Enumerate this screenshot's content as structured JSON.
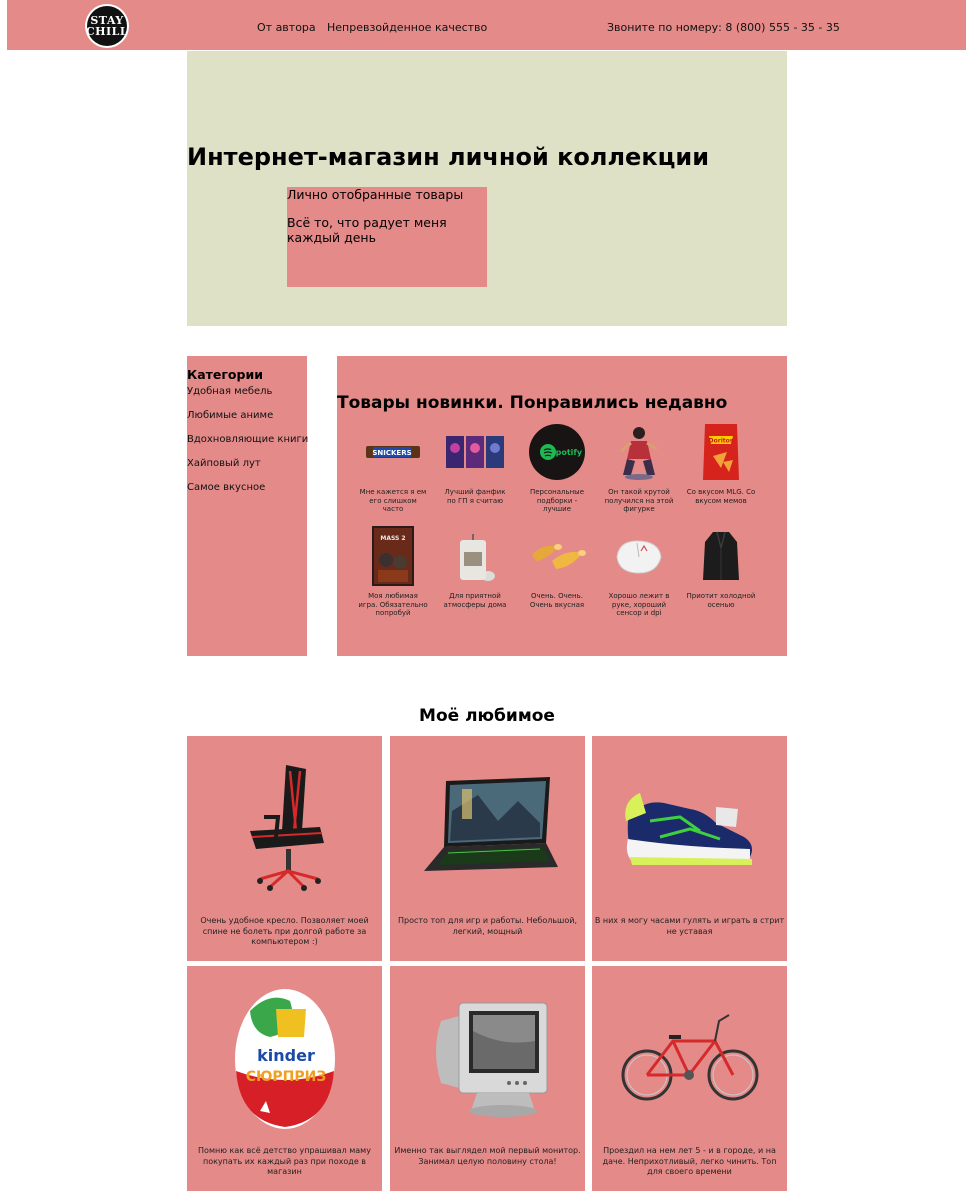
{
  "header": {
    "logo_text": "STAY CHILL",
    "nav": [
      "От автора",
      "Непревзойденное качество"
    ],
    "phone": "Звоните по номеру: 8 (800) 555 - 35 - 35"
  },
  "hero": {
    "title": "Интернет-магазин личной коллекции",
    "line1": "Лично отобранные товары",
    "line2": "Всё то, что радует меня каждый день"
  },
  "categories": {
    "title": "Категории",
    "items": [
      "Удобная мебель",
      "Любимые аниме",
      "Вдохновляющие книги",
      "Хайповый лут",
      "Самое вкусное"
    ]
  },
  "new_products": {
    "title": "Товары новинки. Понравились недавно",
    "items": [
      {
        "icon": "snickers-icon",
        "caption": "Мне кажется я ем его слишком часто"
      },
      {
        "icon": "fanfic-books-icon",
        "caption": "Лучший фанфик по ГП я считаю"
      },
      {
        "icon": "spotify-icon",
        "caption": "Персональные подборки - лучшие"
      },
      {
        "icon": "figurine-icon",
        "caption": "Он такой крутой получился на этой фигурке"
      },
      {
        "icon": "doritos-icon",
        "caption": "Со вкусом MLG. Со вкусом мемов"
      },
      {
        "icon": "mass-effect-icon",
        "caption": "Моя любимая игра. Обязательно попробуй"
      },
      {
        "icon": "candle-icon",
        "caption": "Для приятной атмосферы дома"
      },
      {
        "icon": "burrito-icon",
        "caption": "Очень. Очень. Очень вкусная"
      },
      {
        "icon": "mouse-icon",
        "caption": "Хорошо лежит в руке, хороший сенсор и dpi"
      },
      {
        "icon": "coat-icon",
        "caption": "Приотит холодной осенью"
      }
    ]
  },
  "favorites": {
    "title": "Моё любимое",
    "items": [
      {
        "icon": "gaming-chair-icon",
        "caption": "Очень удобное кресло. Позволяет моей спине не болеть при долгой работе за компьютером :)"
      },
      {
        "icon": "laptop-icon",
        "caption": "Просто топ для игр и работы. Небольшой, легкий, мощный"
      },
      {
        "icon": "sneaker-icon",
        "caption": "В них я могу часами гулять и играть в стрит не уставая"
      },
      {
        "icon": "kinder-egg-icon",
        "caption": "Помню как всё детство упрашивал маму покупать их каждый раз при походе в магазин"
      },
      {
        "icon": "crt-monitor-icon",
        "caption": "Именно так выглядел мой первый монитор. Занимал целую половину стола!"
      },
      {
        "icon": "bicycle-icon",
        "caption": "Проездил на нем лет 5 - и в городе, и на даче. Неприхотливый, легко чинить. Топ для своего времени"
      }
    ]
  }
}
